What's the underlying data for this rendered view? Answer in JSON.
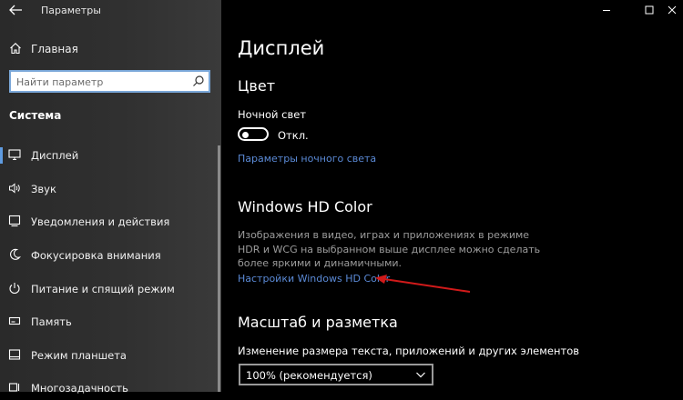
{
  "window": {
    "title": "Параметры",
    "controls": [
      "minimize-icon",
      "maximize-icon",
      "close-icon"
    ]
  },
  "sidebar": {
    "home_label": "Главная",
    "search": {
      "placeholder": "Найти параметр",
      "value": ""
    },
    "section_title": "Система",
    "items": [
      {
        "label": "Дисплей",
        "icon": "monitor-icon",
        "active": true
      },
      {
        "label": "Звук",
        "icon": "speaker-icon"
      },
      {
        "label": "Уведомления и действия",
        "icon": "notification-icon"
      },
      {
        "label": "Фокусировка внимания",
        "icon": "moon-icon"
      },
      {
        "label": "Питание и спящий режим",
        "icon": "power-icon"
      },
      {
        "label": "Память",
        "icon": "storage-icon"
      },
      {
        "label": "Режим планшета",
        "icon": "tablet-icon"
      },
      {
        "label": "Многозадачность",
        "icon": "multitask-icon"
      }
    ]
  },
  "main": {
    "page_title": "Дисплей",
    "color_section": {
      "heading": "Цвет",
      "night_light_label": "Ночной свет",
      "toggle_state": "Откл.",
      "night_light_link": "Параметры ночного света"
    },
    "hdr_section": {
      "heading": "Windows HD Color",
      "description": "Изображения в видео, играх и приложениях в режиме HDR и WCG на выбранном выше дисплее можно сделать более яркими и динамичными.",
      "link": "Настройки Windows HD Color"
    },
    "scale_section": {
      "heading": "Масштаб и разметка",
      "size_label": "Изменение размера текста, приложений и других элементов",
      "dropdown_value": "100% (рекомендуется)"
    }
  },
  "colors": {
    "accent": "#5f9be0",
    "link": "#5b8ad6",
    "annotation_arrow": "#d11a1a"
  }
}
